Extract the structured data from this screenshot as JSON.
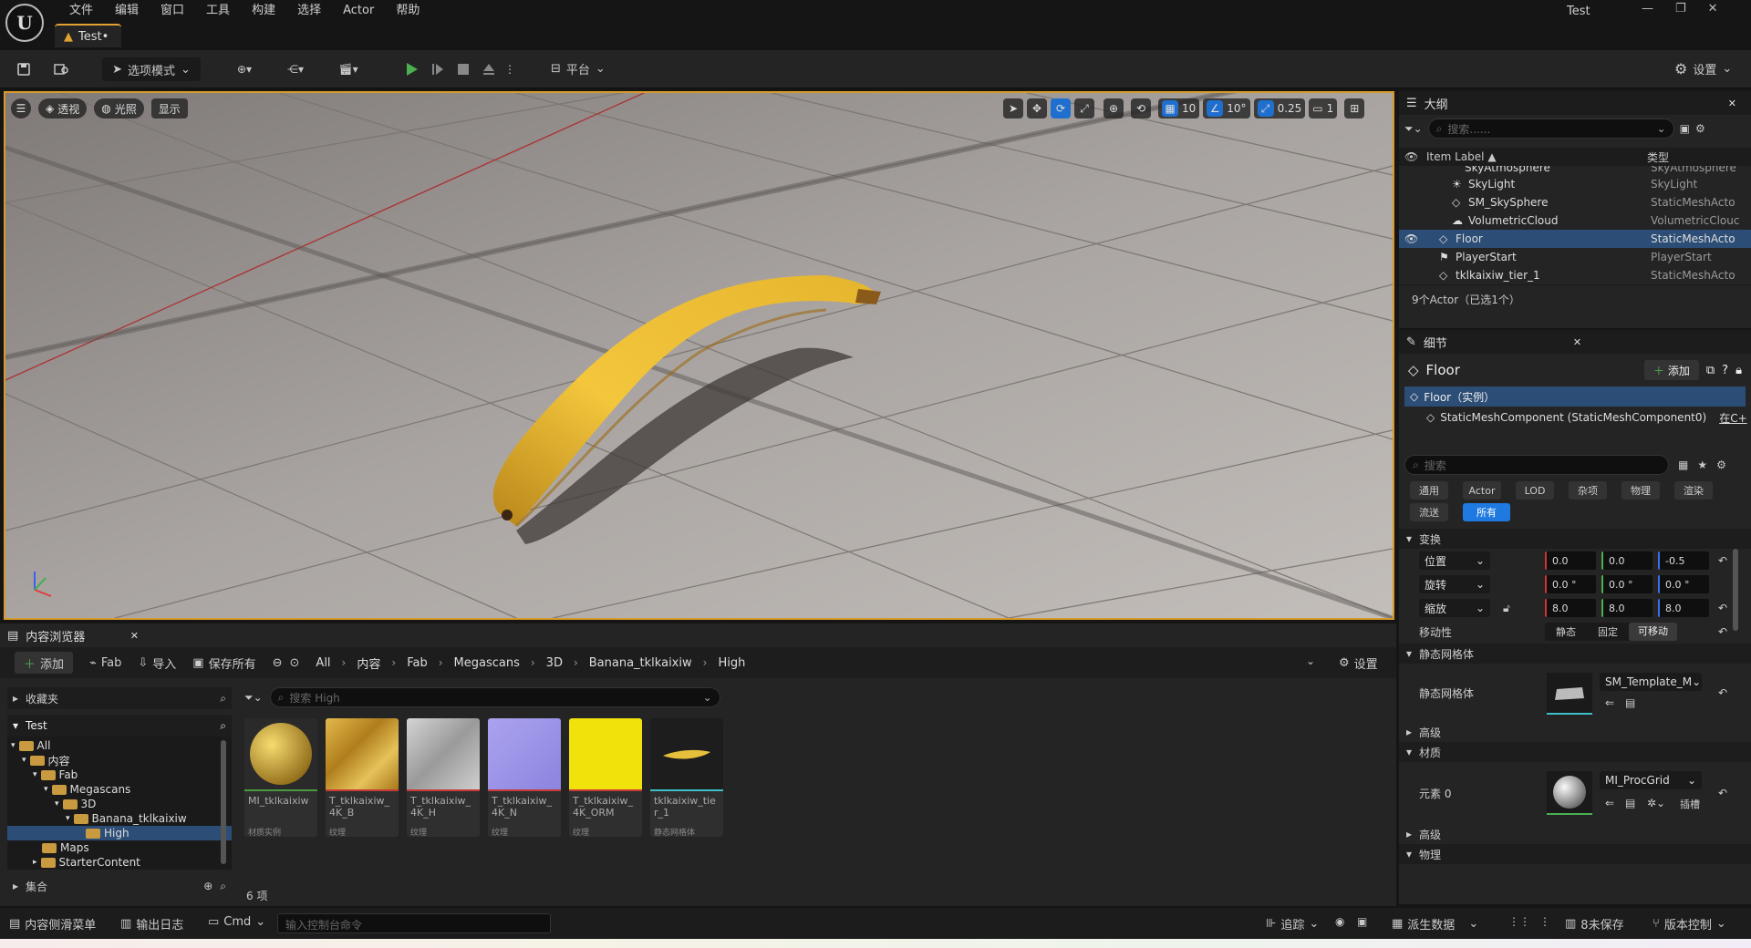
{
  "menu": {
    "items": [
      "文件",
      "编辑",
      "窗口",
      "工具",
      "构建",
      "选择",
      "Actor",
      "帮助"
    ],
    "window_title": "Test"
  },
  "tab": {
    "label": "Test•"
  },
  "toolbar": {
    "mode_label": "选项模式",
    "platform_label": "平台",
    "settings_label": "设置"
  },
  "viewport": {
    "perspective_label": "透视",
    "lighting_label": "光照",
    "show_label": "显示",
    "grid_snap": "10",
    "rotation_snap": "10°",
    "scale_snap": "0.25",
    "camera_speed": "1"
  },
  "outliner": {
    "title": "大纲",
    "search_placeholder": "搜索......",
    "col_label": "Item Label ▲",
    "col_type": "类型",
    "rows": [
      {
        "name": "SkyAtmosphere",
        "type": "SkyAtmosphere",
        "selected": false
      },
      {
        "name": "SkyLight",
        "type": "SkyLight",
        "selected": false
      },
      {
        "name": "SM_SkySphere",
        "type": "StaticMeshActo",
        "selected": false
      },
      {
        "name": "VolumetricCloud",
        "type": "VolumetricClouc",
        "selected": false
      },
      {
        "name": "Floor",
        "type": "StaticMeshActo",
        "selected": true
      },
      {
        "name": "PlayerStart",
        "type": "PlayerStart",
        "selected": false
      },
      {
        "name": "tklkaixiw_tier_1",
        "type": "StaticMeshActo",
        "selected": false
      }
    ],
    "footer": "9个Actor（已选1个）"
  },
  "details": {
    "title": "细节",
    "object_name": "Floor",
    "add_label": "添加",
    "instance_label": "Floor（实例）",
    "component_label": "StaticMeshComponent (StaticMeshComponent0)",
    "component_link": "在C+",
    "search_placeholder": "搜索",
    "categories": [
      "通用",
      "Actor",
      "LOD",
      "杂项",
      "物理",
      "渲染",
      "流送",
      "所有"
    ],
    "active_category": "所有",
    "transform_section": "变换",
    "location_label": "位置",
    "rotation_label": "旋转",
    "scale_label": "缩放",
    "location": [
      "0.0",
      "0.0",
      "-0.5"
    ],
    "rotation": [
      "0.0 °",
      "0.0 °",
      "0.0 °"
    ],
    "scale": [
      "8.0",
      "8.0",
      "8.0"
    ],
    "mobility_label": "移动性",
    "mobility_options": [
      "静态",
      "固定",
      "可移动"
    ],
    "mobility_selected": "可移动",
    "static_mesh_section": "静态网格体",
    "static_mesh_label": "静态网格体",
    "static_mesh_value": "SM_Template_M",
    "advanced_label": "高级",
    "materials_section": "材质",
    "element_label": "元素 0",
    "material_value": "MI_ProcGrid",
    "material_slot_label": "插槽",
    "advanced_label2": "高级",
    "physics_section": "物理"
  },
  "content_browser": {
    "title": "内容浏览器",
    "add_label": "添加",
    "fab_label": "Fab",
    "import_label": "导入",
    "save_all_label": "保存所有",
    "settings_label": "设置",
    "breadcrumb": [
      "All",
      "内容",
      "Fab",
      "Megascans",
      "3D",
      "Banana_tklkaixiw",
      "High"
    ],
    "favorites_label": "收藏夹",
    "project_label": "Test",
    "tree": [
      {
        "label": "All",
        "depth": 0
      },
      {
        "label": "内容",
        "depth": 1
      },
      {
        "label": "Fab",
        "depth": 2
      },
      {
        "label": "Megascans",
        "depth": 3
      },
      {
        "label": "3D",
        "depth": 4
      },
      {
        "label": "Banana_tklkaixiw",
        "depth": 5
      },
      {
        "label": "High",
        "depth": 6
      },
      {
        "label": "Maps",
        "depth": 2
      },
      {
        "label": "StarterContent",
        "depth": 2
      }
    ],
    "collections_label": "集合",
    "search_placeholder": "搜索 High",
    "item_count": "6 项",
    "assets": [
      {
        "name": "MI_tklkaixiw",
        "type": "材质实例",
        "color": "#c9a53a",
        "bar": "#4c9a3f"
      },
      {
        "name": "T_tklkaixiw_4K_B",
        "type": "纹理",
        "color": "#caa24a",
        "bar": "#c83a3a"
      },
      {
        "name": "T_tklkaixiw_4K_H",
        "type": "纹理",
        "color": "#bdbdbd",
        "bar": "#c83a3a"
      },
      {
        "name": "T_tklkaixiw_4K_N",
        "type": "纹理",
        "color": "#9f97e8",
        "bar": "#c83a3a"
      },
      {
        "name": "T_tklkaixiw_4K_ORM",
        "type": "纹理",
        "color": "#f0e010",
        "bar": "#c83a3a"
      },
      {
        "name": "tklkaixiw_tier_1",
        "type": "静态网格体",
        "color": "#1d1d1d",
        "bar": "#3ec0c8"
      }
    ]
  },
  "statusbar": {
    "content_drawer": "内容侧滑菜单",
    "output_log": "输出日志",
    "cmd": "Cmd",
    "console_placeholder": "输入控制台命令",
    "trace": "追踪",
    "derived_data": "派生数据",
    "unsaved": "8未保存",
    "source_control": "版本控制"
  },
  "colors": {
    "accent": "#1e7ae0",
    "highlight": "#d89a2a",
    "selected_row": "#2c4d75"
  }
}
